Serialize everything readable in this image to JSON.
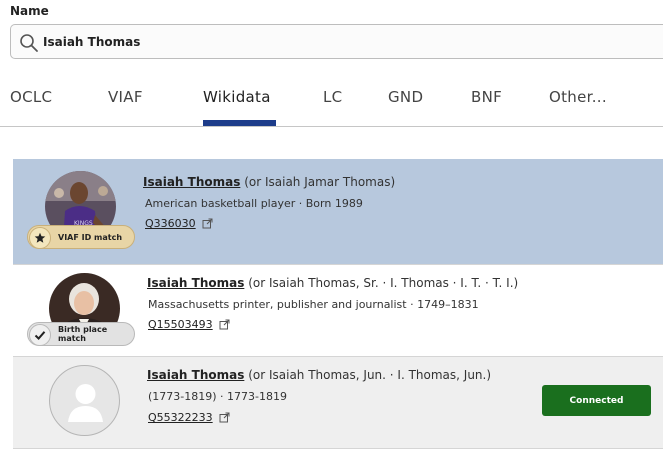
{
  "field": {
    "label": "Name"
  },
  "search": {
    "value": "Isaiah Thomas"
  },
  "tabs": [
    {
      "label": "OCLC"
    },
    {
      "label": "VIAF"
    },
    {
      "label": "Wikidata",
      "active": true
    },
    {
      "label": "LC"
    },
    {
      "label": "GND"
    },
    {
      "label": "BNF"
    },
    {
      "label": "Other..."
    }
  ],
  "results": [
    {
      "name": "Isaiah Thomas",
      "aliases": "(or Isaiah Jamar Thomas)",
      "description": "American basketball player · Born 1989",
      "qid": "Q336030",
      "badge": {
        "label": "VIAF ID match",
        "icon": "star-icon"
      },
      "selected": true
    },
    {
      "name": "Isaiah Thomas",
      "aliases": "(or Isaiah Thomas, Sr. · I. Thomas · I. T. · T. I.)",
      "description": "Massachusetts printer, publisher and journalist · 1749–1831",
      "qid": "Q15503493",
      "badge": {
        "label": "Birth place match",
        "icon": "checkmark-icon"
      }
    },
    {
      "name": "Isaiah Thomas",
      "aliases": "(or Isaiah Thomas, Jun. · I. Thomas, Jun.)",
      "description": "(1773-1819) · 1773-1819",
      "qid": "Q55322233",
      "status": "Connected"
    }
  ],
  "colors": {
    "active_tab_underline": "#1d3c8a",
    "selected_row": "#b7c8dd",
    "connected": "#1a6f1e",
    "viaf_badge": "#e8d5a6"
  }
}
